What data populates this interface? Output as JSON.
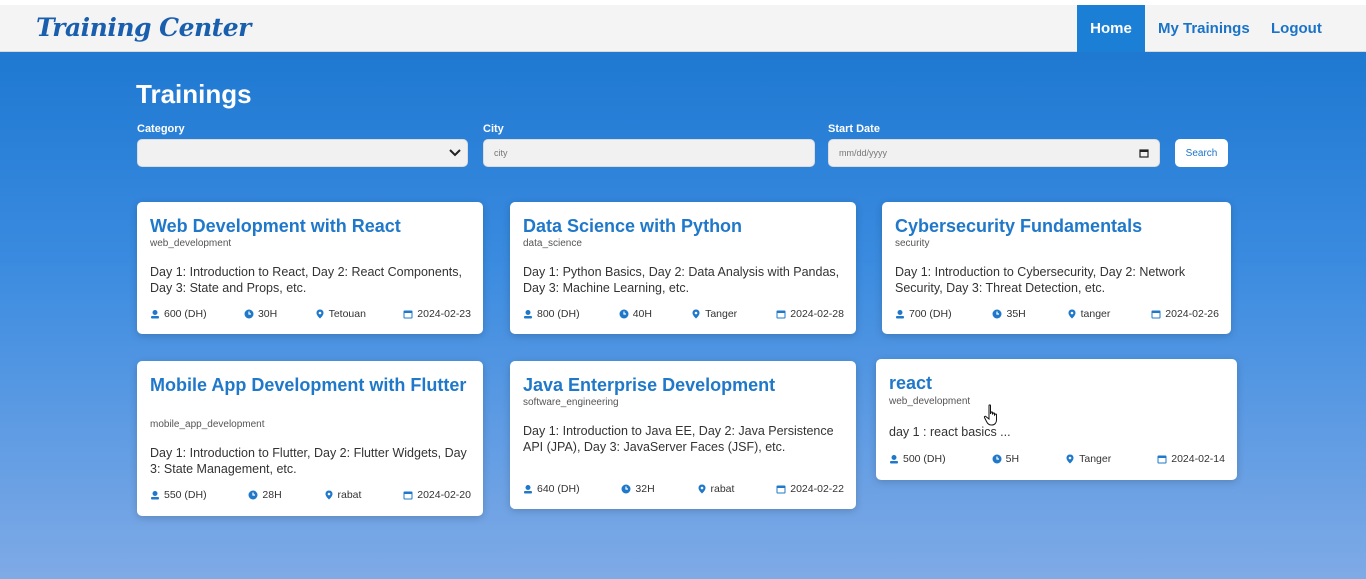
{
  "app": {
    "brand": "Training Center"
  },
  "nav": {
    "home": "Home",
    "my_trainings": "My Trainings",
    "logout": "Logout"
  },
  "page": {
    "title": "Trainings"
  },
  "filters": {
    "category_label": "Category",
    "category_value": "",
    "city_label": "City",
    "city_placeholder": "city",
    "date_label": "Start Date",
    "date_placeholder": "mm/dd/yyyy",
    "search_button": "Search"
  },
  "colors": {
    "accent": "#1f78c9",
    "nav_active": "#1c7fd6",
    "background_top": "#1874cd",
    "background_bottom": "#7faae6"
  },
  "trainings": [
    {
      "title": "Web Development with React",
      "category": "web_development",
      "description": "Day 1: Introduction to React, Day 2: React Components, Day 3: State and Props, etc.",
      "price": "600 (DH)",
      "duration": "30H",
      "city": "Tetouan",
      "date": "2024-02-23"
    },
    {
      "title": "Data Science with Python",
      "category": "data_science",
      "description": "Day 1: Python Basics, Day 2: Data Analysis with Pandas, Day 3: Machine Learning, etc.",
      "price": "800 (DH)",
      "duration": "40H",
      "city": "Tanger",
      "date": "2024-02-28"
    },
    {
      "title": "Cybersecurity Fundamentals",
      "category": "security",
      "description": "Day 1: Introduction to Cybersecurity, Day 2: Network Security, Day 3: Threat Detection, etc.",
      "price": "700 (DH)",
      "duration": "35H",
      "city": "tanger",
      "date": "2024-02-26"
    },
    {
      "title": "Mobile App Development with Flutter",
      "category": "mobile_app_development",
      "description": "Day 1: Introduction to Flutter, Day 2: Flutter Widgets, Day 3: State Management, etc.",
      "price": "550 (DH)",
      "duration": "28H",
      "city": "rabat",
      "date": "2024-02-20"
    },
    {
      "title": "Java Enterprise Development",
      "category": "software_engineering",
      "description": "Day 1: Introduction to Java EE, Day 2: Java Persistence API (JPA), Day 3: JavaServer Faces (JSF), etc.",
      "price": "640 (DH)",
      "duration": "32H",
      "city": "rabat",
      "date": "2024-02-22"
    },
    {
      "title": "react",
      "category": "web_development",
      "description": "day 1 : react basics ...",
      "price": "500 (DH)",
      "duration": "5H",
      "city": "Tanger",
      "date": "2024-02-14"
    }
  ]
}
